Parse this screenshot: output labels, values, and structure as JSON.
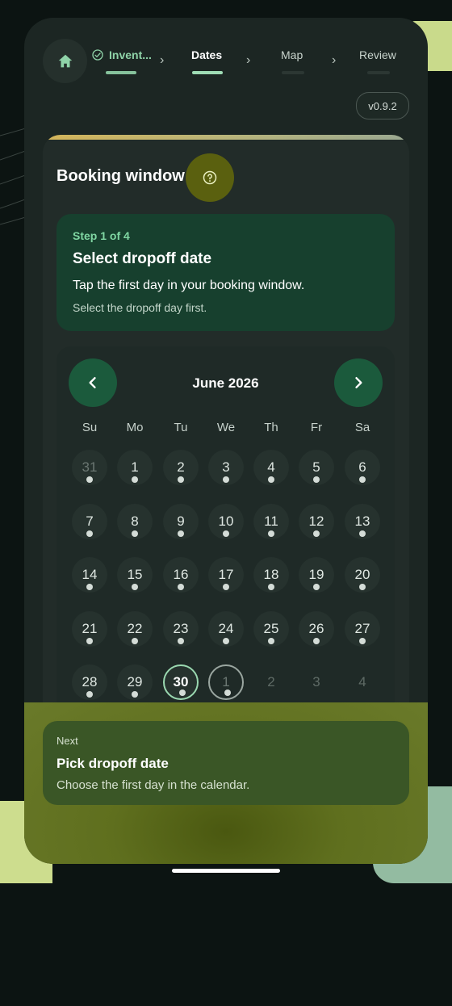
{
  "stepper": {
    "steps": [
      {
        "label": "Invent...",
        "state": "done"
      },
      {
        "label": "Dates",
        "state": "active"
      },
      {
        "label": "Map",
        "state": "upcoming"
      },
      {
        "label": "Review",
        "state": "upcoming"
      }
    ],
    "chevron": "›"
  },
  "version": "v0.9.2",
  "card": {
    "title": "Booking window",
    "step": {
      "count": "Step 1 of 4",
      "title": "Select dropoff date",
      "description": "Tap the first day in your booking window.",
      "hint": "Select the dropoff day first."
    }
  },
  "calendar": {
    "month": "June 2026",
    "weekdays": [
      "Su",
      "Mo",
      "Tu",
      "We",
      "Th",
      "Fr",
      "Sa"
    ],
    "weeks": [
      [
        "31",
        "1",
        "2",
        "3",
        "4",
        "5",
        "6"
      ],
      [
        "7",
        "8",
        "9",
        "10",
        "11",
        "12",
        "13"
      ],
      [
        "14",
        "15",
        "16",
        "17",
        "18",
        "19",
        "20"
      ],
      [
        "21",
        "22",
        "23",
        "24",
        "25",
        "26",
        "27"
      ],
      [
        "28",
        "29",
        "30",
        "1",
        "2",
        "3",
        "4"
      ]
    ],
    "today": "30"
  },
  "footer": {
    "kicker": "Next",
    "title": "Pick dropoff date",
    "description": "Choose the first day in the calendar."
  },
  "colors": {
    "accent": "#8fd3a8",
    "nav_button": "#1b5a3c",
    "help_button": "#5a600f",
    "step_card": "#17402e"
  },
  "icons": {
    "home": "home-icon",
    "check": "check-circle-icon",
    "help": "help-circle-icon",
    "prev": "chevron-left-icon",
    "next": "chevron-right-icon"
  }
}
